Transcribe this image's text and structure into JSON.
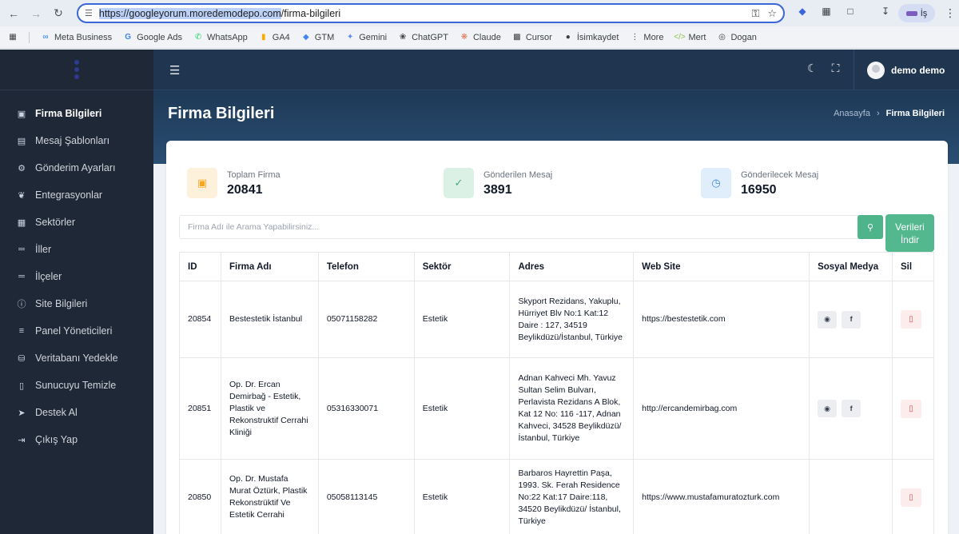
{
  "browser": {
    "url_host": "https://googleyorum.moredemodepo.com",
    "url_path": "/firma-bilgileri",
    "profile_label": "İş",
    "bookmarks": [
      "Meta Business",
      "Google Ads",
      "WhatsApp",
      "GA4",
      "GTM",
      "Gemini",
      "ChatGPT",
      "Claude",
      "Cursor",
      "İsimkaydet",
      "More",
      "Mert",
      "Dogan"
    ]
  },
  "topbar": {
    "user_name": "demo demo"
  },
  "sidebar": {
    "items": [
      {
        "label": "Firma Bilgileri",
        "icon": "briefcase-icon"
      },
      {
        "label": "Mesaj Şablonları",
        "icon": "message-icon"
      },
      {
        "label": "Gönderim Ayarları",
        "icon": "settings-icon"
      },
      {
        "label": "Entegrasyonlar",
        "icon": "leaf-icon"
      },
      {
        "label": "Sektörler",
        "icon": "store-icon"
      },
      {
        "label": "İller",
        "icon": "signpost-icon"
      },
      {
        "label": "İlçeler",
        "icon": "signpost-icon"
      },
      {
        "label": "Site Bilgileri",
        "icon": "info-icon"
      },
      {
        "label": "Panel Yöneticileri",
        "icon": "user-list-icon"
      },
      {
        "label": "Veritabanı Yedekle",
        "icon": "database-icon"
      },
      {
        "label": "Sunucuyu Temizle",
        "icon": "trash-icon"
      },
      {
        "label": "Destek Al",
        "icon": "rocket-icon"
      },
      {
        "label": "Çıkış Yap",
        "icon": "logout-icon"
      }
    ]
  },
  "header": {
    "title": "Firma Bilgileri",
    "breadcrumb_home": "Anasayfa",
    "breadcrumb_sep": "›",
    "breadcrumb_current": "Firma Bilgileri"
  },
  "stats": [
    {
      "label": "Toplam Firma",
      "value": "20841",
      "color": "#f6a623"
    },
    {
      "label": "Gönderilen Mesaj",
      "value": "3891",
      "color": "#3fae78"
    },
    {
      "label": "Gönderilecek Mesaj",
      "value": "16950",
      "color": "#3b8ee0"
    }
  ],
  "search": {
    "placeholder": "Firma Adı ile Arama Yapabilirsiniz..."
  },
  "download_label": "Verileri İndir",
  "table": {
    "headers": [
      "ID",
      "Firma Adı",
      "Telefon",
      "Sektör",
      "Adres",
      "Web Site",
      "Sosyal Medya",
      "Sil"
    ],
    "rows": [
      {
        "id": "20854",
        "name": "Bestestetik İstanbul",
        "phone": "05071158282",
        "sector": "Estetik",
        "address": "Skyport Rezidans, Yakuplu, Hürriyet Blv No:1 Kat:12 Daire : 127, 34519 Beylikdüzü/İstanbul, Türkiye",
        "web": "https://bestestetik.com"
      },
      {
        "id": "20851",
        "name": "Op. Dr. Ercan Demirbağ - Estetik, Plastik ve Rekonstruktif Cerrahi Kliniği",
        "phone": "05316330071",
        "sector": "Estetik",
        "address": "Adnan Kahveci Mh. Yavuz Sultan Selim Bulvarı, Perlavista Rezidans A Blok, Kat 12 No: 116 -117, Adnan Kahveci, 34528 Beylikdüzü/İstanbul, Türkiye",
        "web": "http://ercandemirbag.com"
      },
      {
        "id": "20850",
        "name": "Op. Dr. Mustafa Murat Öztürk, Plastik Rekonstrüktif Ve Estetik Cerrahi",
        "phone": "05058113145",
        "sector": "Estetik",
        "address": "Barbaros Hayrettin Paşa, 1993. Sk. Ferah Residence No:22 Kat:17 Daire:118, 34520 Beylikdüzü/ İstanbul, Türkiye",
        "web": "https://www.mustafamuratozturk.com"
      }
    ]
  }
}
